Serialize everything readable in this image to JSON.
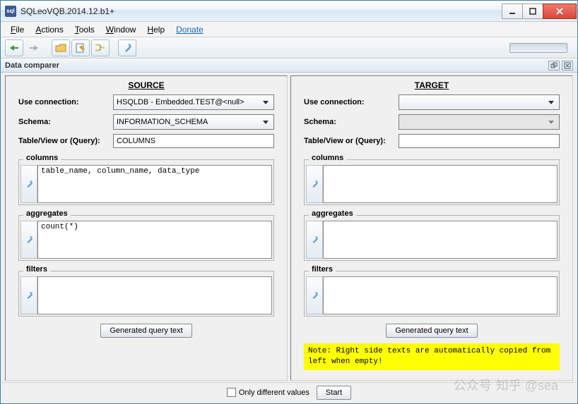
{
  "window": {
    "title": "SQLeoVQB.2014.12.b1+"
  },
  "menu": {
    "file": "File",
    "actions": "Actions",
    "tools": "Tools",
    "window_m": "Window",
    "help": "Help",
    "donate": "Donate"
  },
  "subheader": {
    "title": "Data comparer"
  },
  "source": {
    "header": "SOURCE",
    "labels": {
      "connection": "Use connection:",
      "schema": "Schema:",
      "tableview": "Table/View or (Query):"
    },
    "values": {
      "connection": "HSQLDB - Embedded.TEST@<null>",
      "schema": "INFORMATION_SCHEMA",
      "tableview": "COLUMNS"
    },
    "fieldsets": {
      "columns": {
        "legend": "columns",
        "text": "table_name, column_name, data_type"
      },
      "aggregates": {
        "legend": "aggregates",
        "text": "count(*)"
      },
      "filters": {
        "legend": "filters",
        "text": ""
      }
    },
    "gen_button": "Generated query text"
  },
  "target": {
    "header": "TARGET",
    "labels": {
      "connection": "Use connection:",
      "schema": "Schema:",
      "tableview": "Table/View or (Query):"
    },
    "values": {
      "connection": "",
      "schema": "",
      "tableview": ""
    },
    "fieldsets": {
      "columns": {
        "legend": "columns",
        "text": ""
      },
      "aggregates": {
        "legend": "aggregates",
        "text": ""
      },
      "filters": {
        "legend": "filters",
        "text": ""
      }
    },
    "gen_button": "Generated query text",
    "note": "Note: Right side texts are automatically copied from left when empty!"
  },
  "footer": {
    "only_diff": "Only different values",
    "start": "Start"
  },
  "watermark": {
    "text1": "公众号",
    "text2": "知乎 @sea"
  }
}
